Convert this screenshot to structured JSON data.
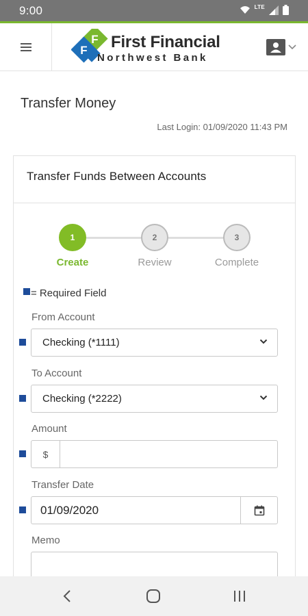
{
  "status_bar": {
    "time": "9:00",
    "network": "LTE",
    "icons": [
      "wifi-icon",
      "signal-icon",
      "battery-icon"
    ]
  },
  "header": {
    "menu_icon": "hamburger-menu-icon",
    "logo": {
      "line1": "First Financial",
      "line2": "Northwest Bank",
      "mark_letters": "FF"
    },
    "user_icon": "user-card-icon",
    "user_chevron": "chevron-down-icon"
  },
  "page": {
    "title": "Transfer Money",
    "last_login": "Last Login: 01/09/2020 11:43 PM"
  },
  "panel": {
    "title": "Transfer Funds Between Accounts",
    "steps": [
      {
        "number": "1",
        "label": "Create",
        "active": true
      },
      {
        "number": "2",
        "label": "Review",
        "active": false
      },
      {
        "number": "3",
        "label": "Complete",
        "active": false
      }
    ],
    "required_note": "= Required Field",
    "fields": {
      "from": {
        "label": "From Account",
        "value": "Checking (*1111)"
      },
      "to": {
        "label": "To Account",
        "value": "Checking (*2222)"
      },
      "amount": {
        "label": "Amount",
        "prefix": "$",
        "value": ""
      },
      "date": {
        "label": "Transfer Date",
        "value": "01/09/2020"
      },
      "memo": {
        "label": "Memo",
        "value": ""
      }
    }
  },
  "nav_bar": {
    "icons": [
      "back-icon",
      "home-icon",
      "recents-icon"
    ]
  },
  "colors": {
    "accent_green": "#82bc26",
    "required_blue": "#1e4c9a",
    "status_bar": "#757575",
    "logo_blue": "#1e6fb9"
  }
}
